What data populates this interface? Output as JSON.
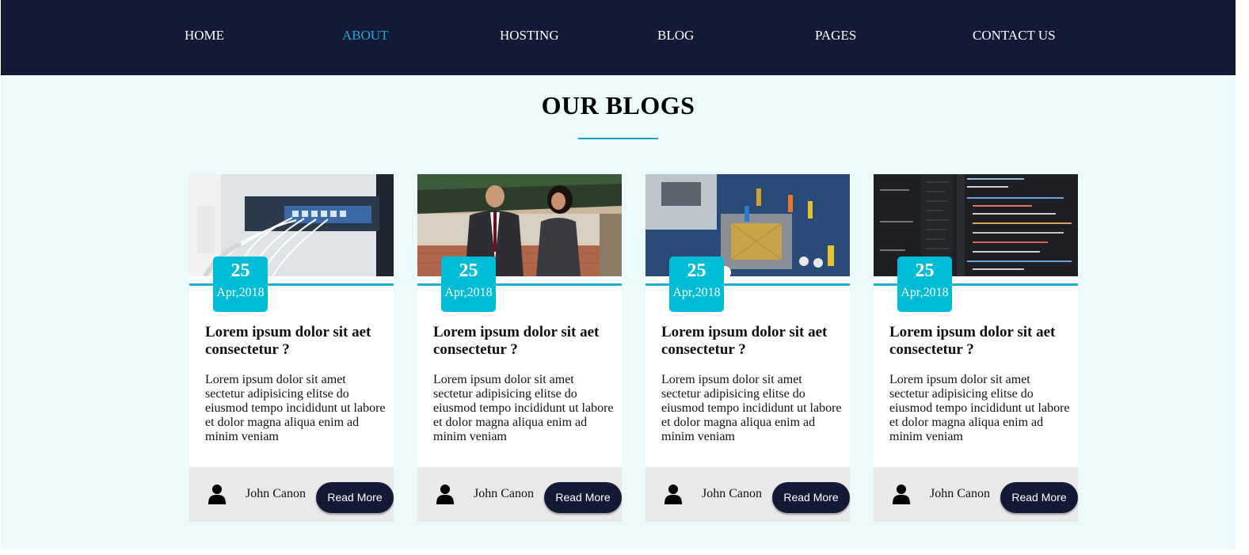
{
  "nav": {
    "items": [
      {
        "label": "HOME",
        "active": false
      },
      {
        "label": "ABOUT",
        "active": true
      },
      {
        "label": "HOSTING",
        "active": false
      },
      {
        "label": "BLOG",
        "active": false
      },
      {
        "label": "PAGES",
        "active": false
      },
      {
        "label": "CONTACT US",
        "active": false
      }
    ]
  },
  "section": {
    "title": "OUR BLOGS"
  },
  "posts": [
    {
      "image": "network-server-cables",
      "day": "25",
      "month": "Apr,2018",
      "title": "Lorem ipsum dolor sit aet consectetur ?",
      "excerpt": "Lorem ipsum dolor sit amet sectetur adipisicing elitse do eiusmod tempo incididunt ut labore et dolor magna aliqua enim ad minim veniam",
      "author": "John Canon",
      "button": "Read More"
    },
    {
      "image": "business-people-talking",
      "day": "25",
      "month": "Apr,2018",
      "title": "Lorem ipsum dolor sit aet consectetur ?",
      "excerpt": "Lorem ipsum dolor sit amet sectetur adipisicing elitse do eiusmod tempo incididunt ut labore et dolor magna aliqua enim ad minim veniam",
      "author": "John Canon",
      "button": "Read More"
    },
    {
      "image": "miniature-workers-on-motherboard",
      "day": "25",
      "month": "Apr,2018",
      "title": "Lorem ipsum dolor sit aet consectetur ?",
      "excerpt": "Lorem ipsum dolor sit amet sectetur adipisicing elitse do eiusmod tempo incididunt ut labore et dolor magna aliqua enim ad minim veniam",
      "author": "John Canon",
      "button": "Read More"
    },
    {
      "image": "code-on-dark-screen",
      "day": "25",
      "month": "Apr,2018",
      "title": "Lorem ipsum dolor sit aet consectetur ?",
      "excerpt": "Lorem ipsum dolor sit amet sectetur adipisicing elitse do eiusmod tempo incididunt ut labore et dolor magna aliqua enim ad minim veniam",
      "author": "John Canon",
      "button": "Read More"
    }
  ],
  "colors": {
    "nav_bg": "#131a35",
    "nav_active": "#1eaad2",
    "section_bg": "#ebfbfb",
    "accent": "#00bcd7",
    "footer_bg": "#e9e9e9"
  }
}
